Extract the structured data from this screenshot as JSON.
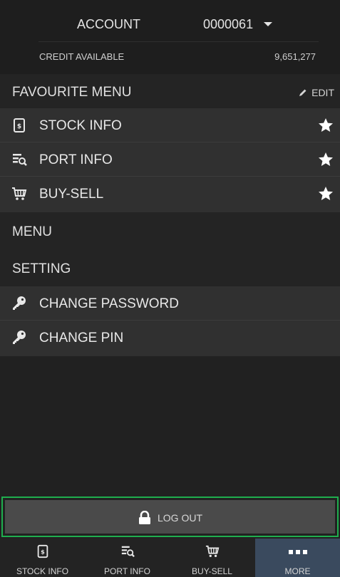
{
  "account": {
    "label": "ACCOUNT",
    "value": "0000061",
    "credit_label": "CREDIT AVAILABLE",
    "credit_value": "9,651,277"
  },
  "favourite": {
    "title": "FAVOURITE MENU",
    "edit_label": "EDIT",
    "items": [
      {
        "label": "STOCK INFO",
        "icon": "stock-info-icon",
        "starred": true
      },
      {
        "label": "PORT INFO",
        "icon": "port-info-icon",
        "starred": true
      },
      {
        "label": "BUY-SELL",
        "icon": "cart-icon",
        "starred": true
      }
    ]
  },
  "menu": {
    "title": "MENU"
  },
  "setting": {
    "title": "SETTING",
    "items": [
      {
        "label": "CHANGE PASSWORD",
        "icon": "key-icon"
      },
      {
        "label": "CHANGE PIN",
        "icon": "key-icon"
      }
    ]
  },
  "logout": {
    "label": "LOG OUT",
    "icon": "lock-icon",
    "highlight_color": "#1fae4e"
  },
  "tabs": [
    {
      "label": "STOCK INFO",
      "icon": "stock-info-icon",
      "active": false
    },
    {
      "label": "PORT INFO",
      "icon": "port-info-icon",
      "active": false
    },
    {
      "label": "BUY-SELL",
      "icon": "cart-icon",
      "active": false
    },
    {
      "label": "MORE",
      "icon": "more-icon",
      "active": true
    }
  ],
  "colors": {
    "background": "#212121",
    "item_background": "#303030",
    "active_tab": "#3a4a5e"
  }
}
